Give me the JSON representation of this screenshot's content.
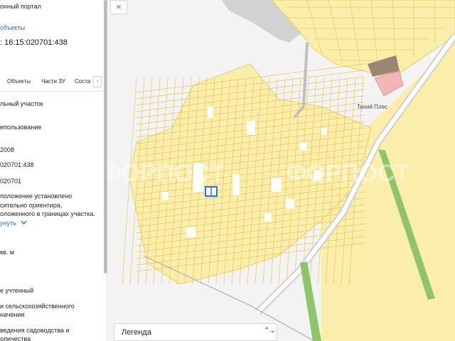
{
  "panel": {
    "portal_title": "онный портал",
    "objects_link": "объекты",
    "cadastral_number": ": 16:15:020701:438",
    "tabs": [
      "Объекты",
      "Части ЗУ",
      "Соста"
    ],
    "tab_arrow": "›",
    "lines": [
      "льный участок",
      "епользование",
      "2008",
      "020701:438",
      "020701",
      "положение установлено",
      "сительно ориентира,",
      "оложенного в границах участка.",
      "кв. м",
      "е учтенный",
      "и сельскохозяйственного",
      "начения",
      "ведения садоводства и",
      "оличества"
    ],
    "expand_link": "унуть",
    "expand_icon": "chevron-down"
  },
  "map": {
    "collapse_icon": "«",
    "place_label": "Тихий Плес",
    "watermark": "ФОРПОСТ",
    "legend_label": "Легенда",
    "legend_icon": "⌃⌄",
    "colors": {
      "parcel_fill": "#fbeeaa",
      "parcel_line": "#e9cf6b",
      "background": "#f3f3f3",
      "water": "#d2d2d2",
      "forest": "#8fc46a",
      "highlight": "#2f6fe0",
      "building": "#9a8674",
      "pink_area": "#f2b6b6"
    }
  }
}
